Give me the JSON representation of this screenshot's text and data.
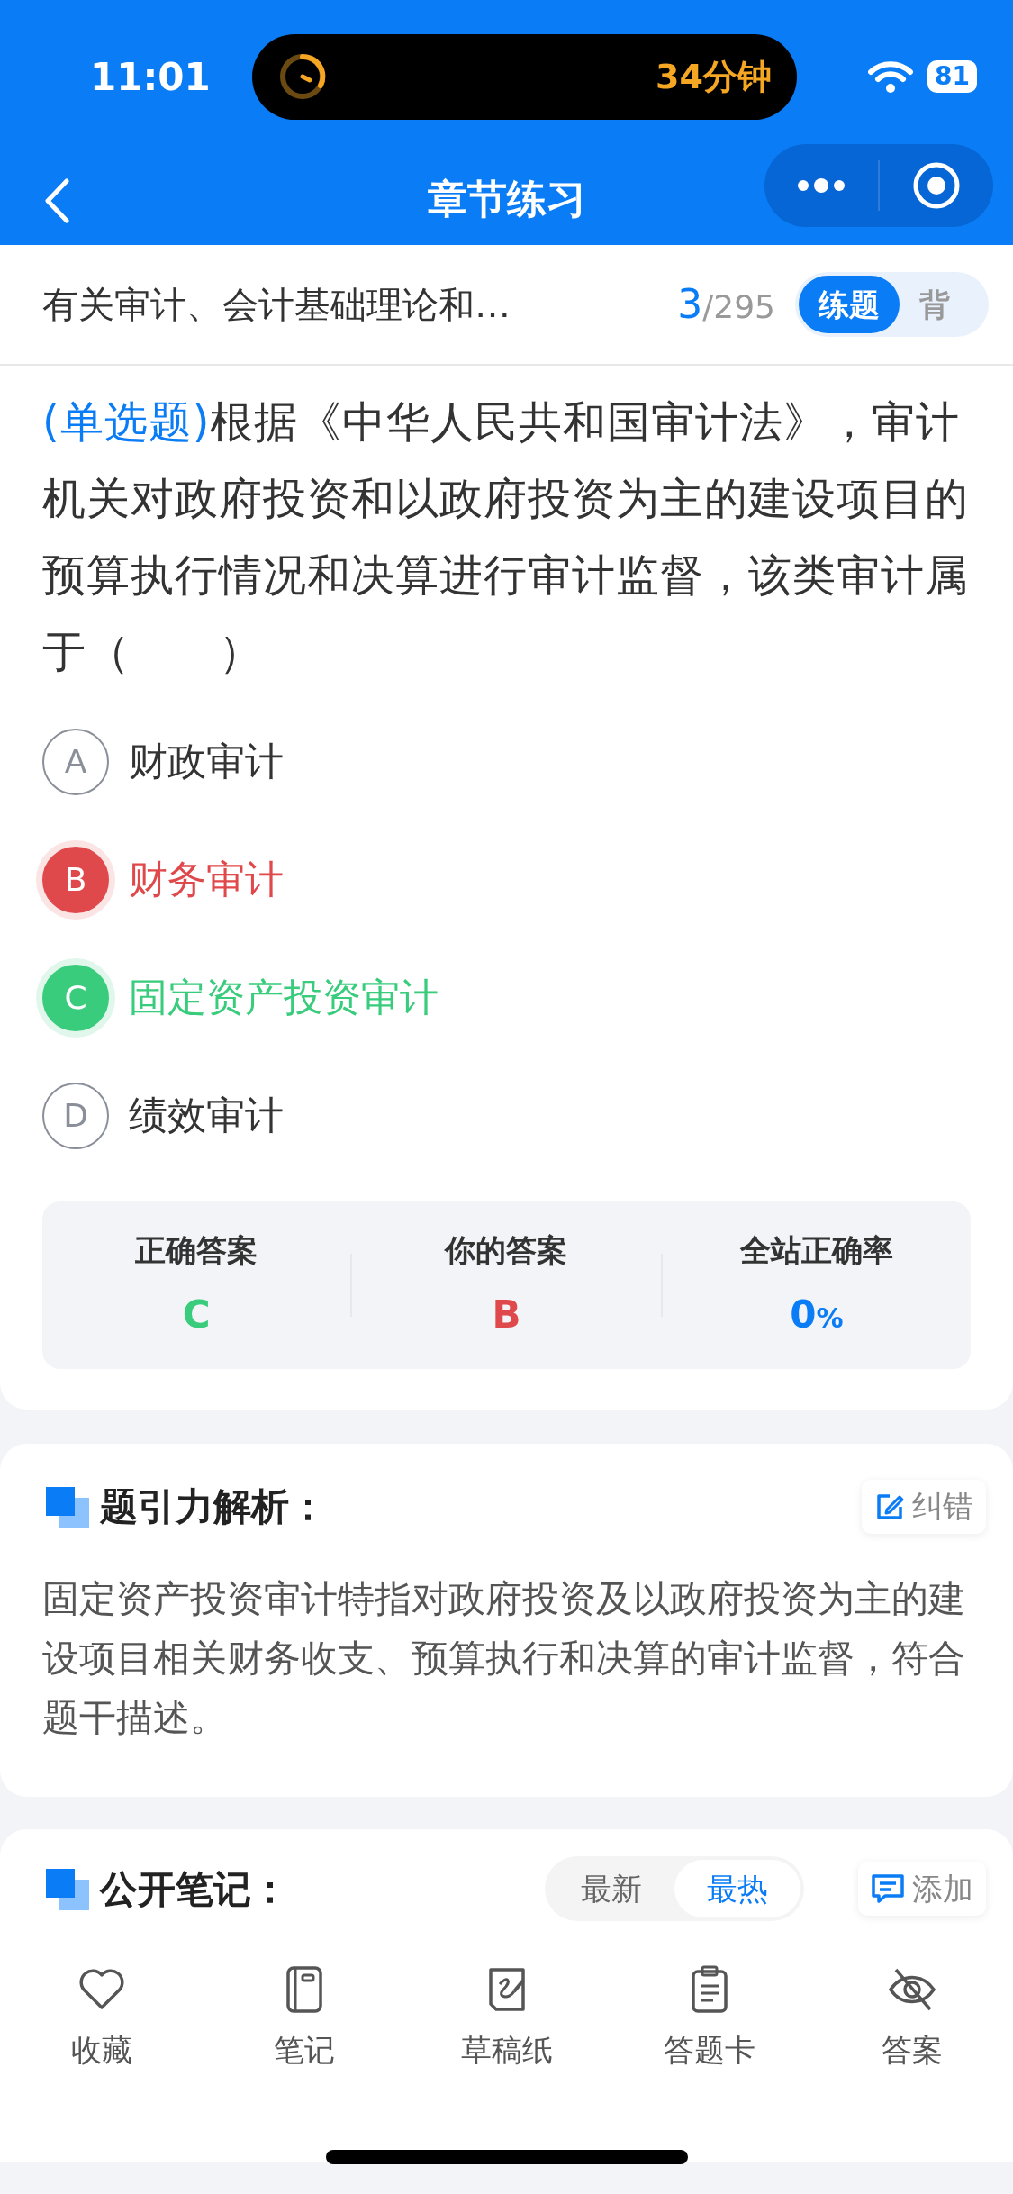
{
  "status_bar": {
    "time": "11:01",
    "activity_timer": "34分钟",
    "battery": "81"
  },
  "nav": {
    "title": "章节练习"
  },
  "chapter": {
    "title": "有关审计、会计基础理论和…",
    "current": "3",
    "total": "/295",
    "modes": [
      {
        "label": "练题",
        "selected": true
      },
      {
        "label": "背",
        "selected": false
      }
    ]
  },
  "question": {
    "type_tag": "(单选题)",
    "text": "根据《中华人民共和国审计法》，审计机关对政府投资和以政府投资为主的建设项目的预算执行情况和决算进行审计监督，该类审计属于（　　）"
  },
  "options": [
    {
      "letter": "A",
      "text": "财政审计",
      "selected": false,
      "correct": false
    },
    {
      "letter": "B",
      "text": "财务审计",
      "selected": true,
      "correct": false
    },
    {
      "letter": "C",
      "text": "固定资产投资审计",
      "selected": false,
      "correct": true
    },
    {
      "letter": "D",
      "text": "绩效审计",
      "selected": false,
      "correct": false
    }
  ],
  "result": [
    {
      "label": "正确答案",
      "value": "C",
      "kind": "correct"
    },
    {
      "label": "你的答案",
      "value": "B",
      "kind": "wrong"
    },
    {
      "label": "全站正确率",
      "value": "0",
      "unit": "%",
      "kind": "rate"
    }
  ],
  "analysis": {
    "title": "题引力解析：",
    "fix_button": "纠错",
    "text": "固定资产投资审计特指对政府投资及以政府投资为主的建设项目相关财务收支、预算执行和决算的审计监督，符合题干描述。"
  },
  "notes": {
    "title": "公开笔记：",
    "sort_tabs": [
      {
        "label": "最新",
        "selected": false
      },
      {
        "label": "最热",
        "selected": true
      }
    ],
    "add_button": "添加"
  },
  "toolbar": [
    {
      "label": "收藏",
      "kind": "heart"
    },
    {
      "label": "笔记",
      "kind": "notebook"
    },
    {
      "label": "草稿纸",
      "kind": "draft"
    },
    {
      "label": "答题卡",
      "kind": "clipboard"
    },
    {
      "label": "答案",
      "kind": "eye"
    }
  ]
}
